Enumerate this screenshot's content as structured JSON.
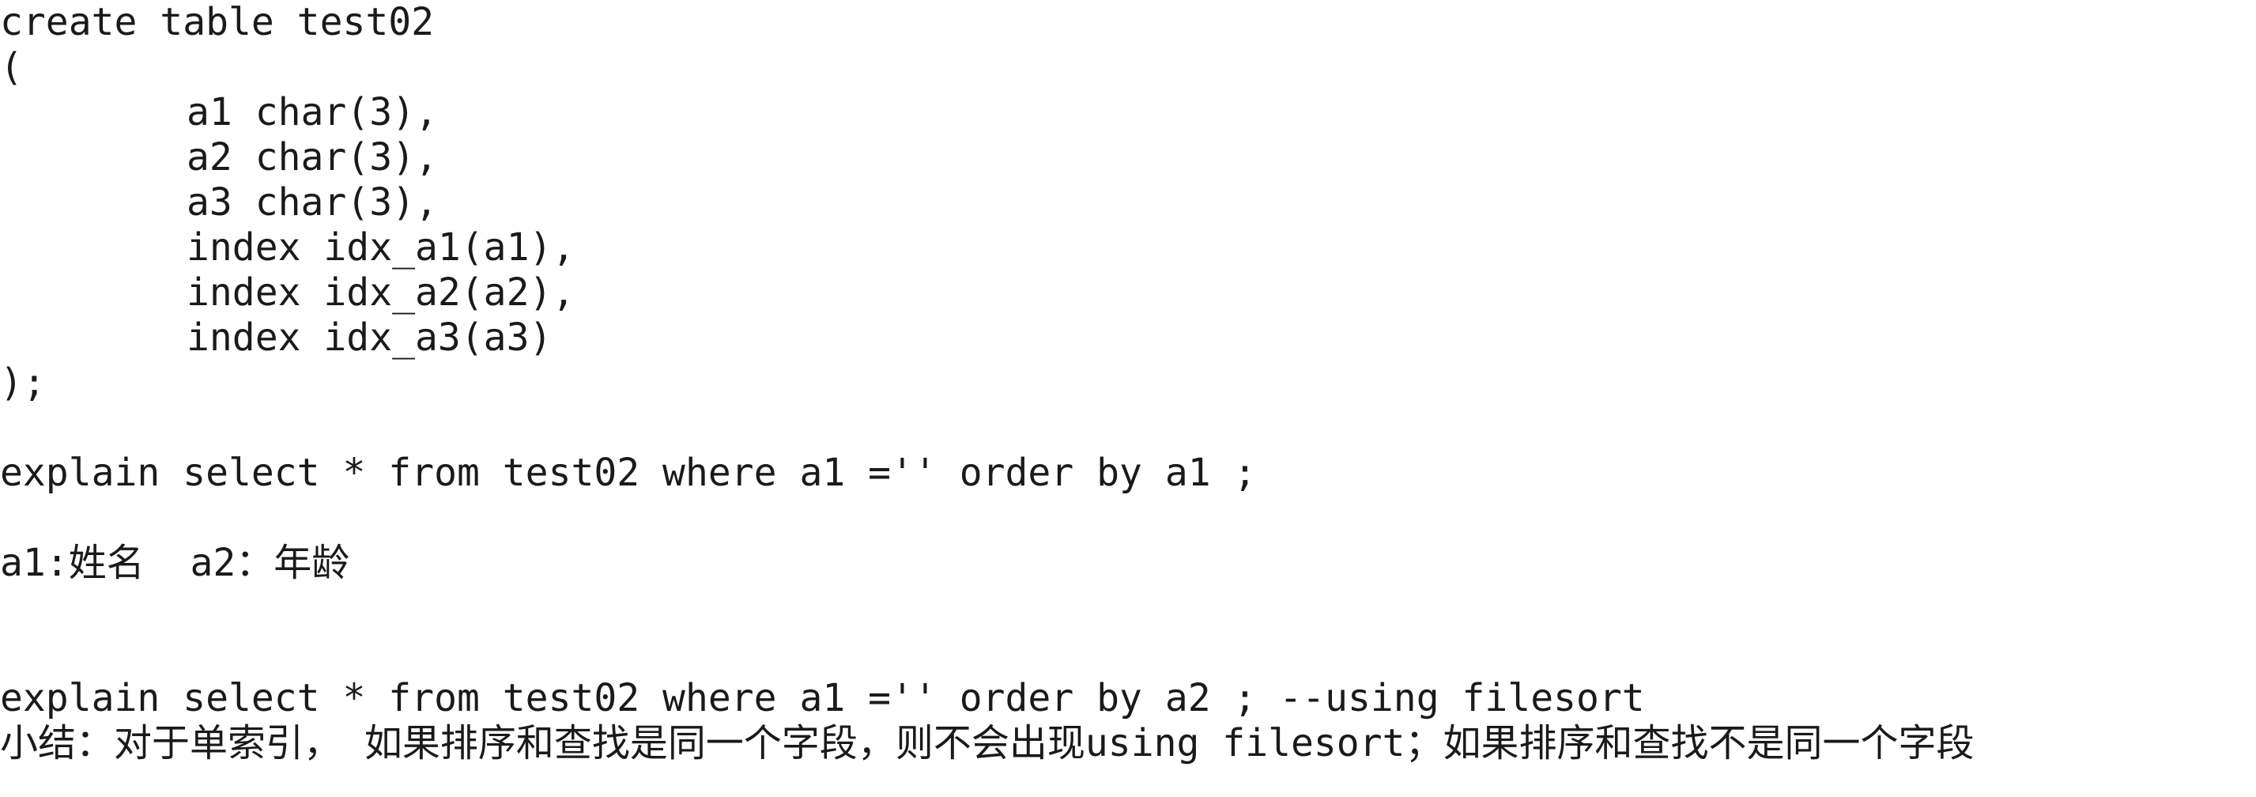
{
  "editor": {
    "lines": [
      "create table test02",
      "(",
      "a1 char(3),",
      "a2 char(3),",
      "a3 char(3),",
      "index idx_a1(a1),",
      "index idx_a2(a2),",
      "index idx_a3(a3)",
      ");",
      "explain select * from test02 where a1 ='' order by a1 ;",
      "a1:姓名  a2：年龄",
      "explain select * from test02 where a1 ='' order by a2 ; --using filesort",
      "小结：对于单索引， 如果排序和查找是同一个字段，则不会出现using filesort；如果排序和查找不是同一个字段"
    ]
  }
}
